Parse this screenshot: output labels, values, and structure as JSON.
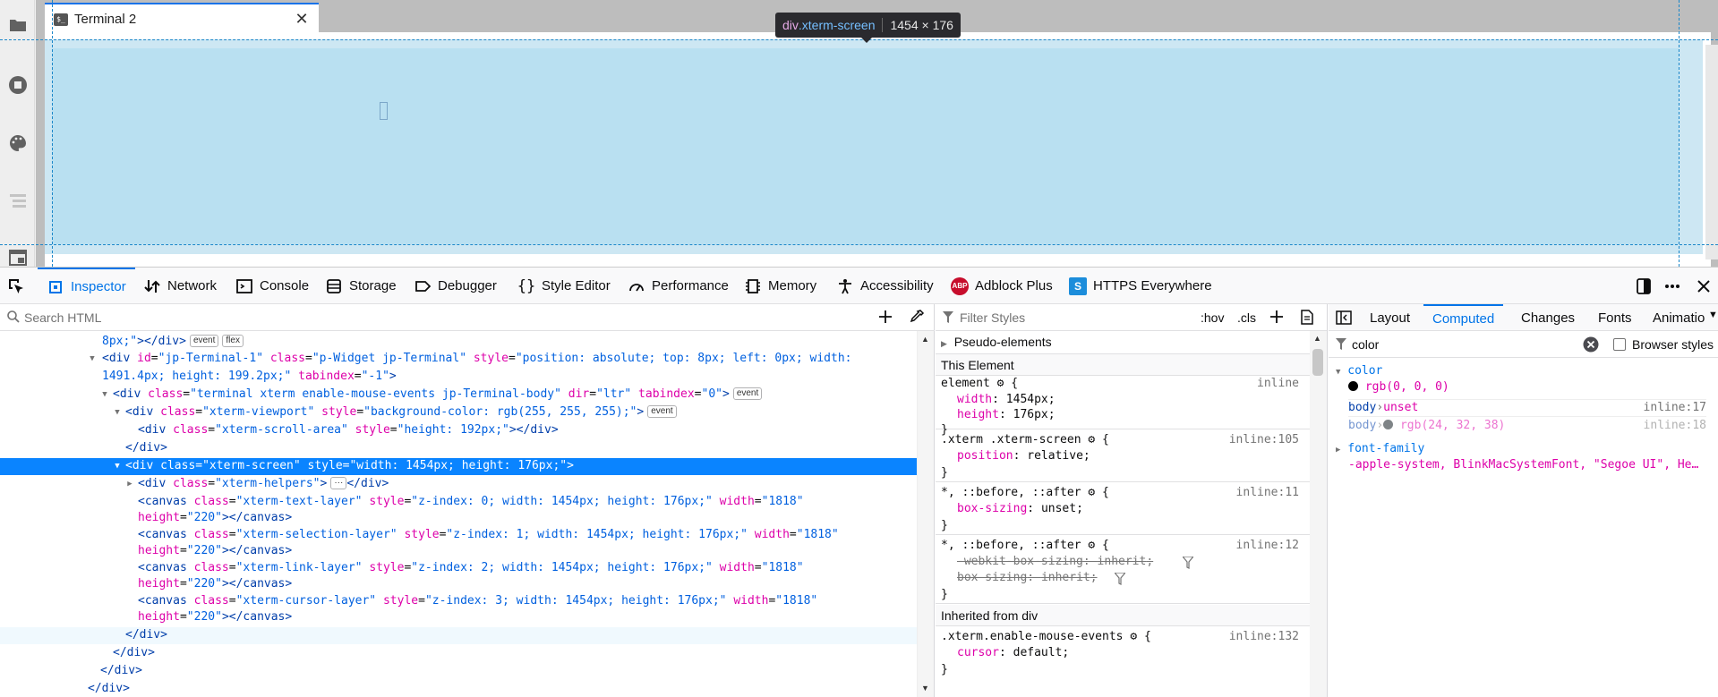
{
  "page": {
    "tab_title": "Terminal 2",
    "tab_icon_text": "$_",
    "close_glyph": "✕",
    "tooltip": {
      "tag": "div",
      "cls": ".xterm-screen",
      "size": "1454 × 176"
    }
  },
  "devtools": {
    "tabs": {
      "inspector": "Inspector",
      "network": "Network",
      "console": "Console",
      "storage": "Storage",
      "debugger": "Debugger",
      "style_editor": "Style Editor",
      "performance": "Performance",
      "memory": "Memory",
      "accessibility": "Accessibility",
      "adblock": "Adblock Plus",
      "https": "HTTPS Everywhere"
    },
    "adblock_badge": "ABP",
    "https_badge": "S",
    "markup": {
      "search_placeholder": "Search HTML",
      "lines": [
        {
          "text_html": "<span class=\"av\">8px;\"</span><span class=\"t\">&gt;&lt;/div&gt;</span><span class=\"badge\">event</span><span class=\"badge\">flex</span>"
        },
        {
          "text_html": "<span class=\"t\">&lt;div </span><span class=\"an\">id</span>=<span class=\"av\">\"jp-Terminal-1\"</span> <span class=\"an\">class</span>=<span class=\"av\">\"p-Widget jp-Terminal\"</span> <span class=\"an\">style</span>=<span class=\"av\">\"position: absolute; top: 8px; left: 0px; width:</span>"
        },
        {
          "text_html": "<span class=\"av\">1491.4px; height: 199.2px;\"</span> <span class=\"an\">tabindex</span>=<span class=\"av\">\"-1\"</span><span class=\"t\">&gt;</span>"
        },
        {
          "text_html": "<span class=\"t\">&lt;div </span><span class=\"an\">class</span>=<span class=\"av\">\"terminal xterm enable-mouse-events jp-Terminal-body\"</span> <span class=\"an\">dir</span>=<span class=\"av\">\"ltr\"</span> <span class=\"an\">tabindex</span>=<span class=\"av\">\"0\"</span><span class=\"t\">&gt;</span><span class=\"badge\">event</span>"
        },
        {
          "text_html": "<span class=\"t\">&lt;div </span><span class=\"an\">class</span>=<span class=\"av\">\"xterm-viewport\"</span> <span class=\"an\">style</span>=<span class=\"av\">\"background-color: rgb(255, 255, 255);\"</span><span class=\"t\">&gt;</span><span class=\"badge\">event</span>"
        },
        {
          "text_html": "<span class=\"t\">&lt;div </span><span class=\"an\">class</span>=<span class=\"av\">\"xterm-scroll-area\"</span> <span class=\"an\">style</span>=<span class=\"av\">\"height: 192px;\"</span><span class=\"t\">&gt;&lt;/div&gt;</span>"
        },
        {
          "text_html": "<span class=\"t\">&lt;/div&gt;</span>"
        },
        {
          "text_html": "<span class=\"t\">&lt;div </span><span class=\"an\">class</span>=<span class=\"av\">\"xterm-screen\"</span> <span class=\"an\">style</span>=<span class=\"av\">\"width: 1454px; height: 176px;\"</span><span class=\"t\">&gt;</span>"
        },
        {
          "text_html": "<span class=\"t\">&lt;div </span><span class=\"an\">class</span>=<span class=\"av\">\"xterm-helpers\"</span><span class=\"t\">&gt;</span><span class=\"badge\">···</span><span class=\"t\">&lt;/div&gt;</span>"
        },
        {
          "text_html": "<span class=\"t\">&lt;canvas </span><span class=\"an\">class</span>=<span class=\"av\">\"xterm-text-layer\"</span> <span class=\"an\">style</span>=<span class=\"av\">\"z-index: 0; width: 1454px; height: 176px;\"</span> <span class=\"an\">width</span>=<span class=\"av\">\"1818\"</span>"
        },
        {
          "text_html": "<span class=\"an\">height</span>=<span class=\"av\">\"220\"</span><span class=\"t\">&gt;&lt;/canvas&gt;</span>"
        },
        {
          "text_html": "<span class=\"t\">&lt;canvas </span><span class=\"an\">class</span>=<span class=\"av\">\"xterm-selection-layer\"</span> <span class=\"an\">style</span>=<span class=\"av\">\"z-index: 1; width: 1454px; height: 176px;\"</span> <span class=\"an\">width</span>=<span class=\"av\">\"1818\"</span>"
        },
        {
          "text_html": "<span class=\"an\">height</span>=<span class=\"av\">\"220\"</span><span class=\"t\">&gt;&lt;/canvas&gt;</span>"
        },
        {
          "text_html": "<span class=\"t\">&lt;canvas </span><span class=\"an\">class</span>=<span class=\"av\">\"xterm-link-layer\"</span> <span class=\"an\">style</span>=<span class=\"av\">\"z-index: 2; width: 1454px; height: 176px;\"</span> <span class=\"an\">width</span>=<span class=\"av\">\"1818\"</span>"
        },
        {
          "text_html": "<span class=\"an\">height</span>=<span class=\"av\">\"220\"</span><span class=\"t\">&gt;&lt;/canvas&gt;</span>"
        },
        {
          "text_html": "<span class=\"t\">&lt;canvas </span><span class=\"an\">class</span>=<span class=\"av\">\"xterm-cursor-layer\"</span> <span class=\"an\">style</span>=<span class=\"av\">\"z-index: 3; width: 1454px; height: 176px;\"</span> <span class=\"an\">width</span>=<span class=\"av\">\"1818\"</span>"
        },
        {
          "text_html": "<span class=\"an\">height</span>=<span class=\"av\">\"220\"</span><span class=\"t\">&gt;&lt;/canvas&gt;</span>"
        },
        {
          "text_html": "<span class=\"t\">&lt;/div&gt;</span>"
        },
        {
          "text_html": "<span class=\"t\">&lt;/div&gt;</span>"
        },
        {
          "text_html": "<span class=\"t\">&lt;/div&gt;</span>"
        },
        {
          "text_html": "<span class=\"t\">&lt;/div&gt;</span>"
        },
        {
          "text_html": "<span class=\"t\">&lt;/div&gt;</span>"
        }
      ]
    },
    "rules": {
      "filter_placeholder": "Filter Styles",
      "hov": ":hov",
      "cls": ".cls",
      "pseudo": "Pseudo-elements",
      "this_element": "This Element",
      "inherited_from": "Inherited from div",
      "r1_sel": "element",
      "r1_src": "inline",
      "r1_p1": "width",
      "r1_v1": "1454px",
      "r1_p2": "height",
      "r1_v2": "176px",
      "r2_sel": ".xterm .xterm-screen",
      "r2_src": "inline:105",
      "r2_p1": "position",
      "r2_v1": "relative",
      "r3_sel": "*, ::before, ::after",
      "r3_src": "inline:11",
      "r3_p1": "box-sizing",
      "r3_v1": "unset",
      "r4_sel": "*, ::before, ::after",
      "r4_src": "inline:12",
      "r4_p1": "-webkit-box-sizing",
      "r4_v1": "inherit",
      "r4_p2": "box-sizing",
      "r4_v2": "inherit",
      "r5_sel": ".xterm.enable-mouse-events",
      "r5_src": "inline:132",
      "r5_p1": "cursor",
      "r5_v1": "default"
    },
    "computed": {
      "tabs": {
        "layout": "Layout",
        "computed": "Computed",
        "changes": "Changes",
        "fonts": "Fonts",
        "animations": "Animatio"
      },
      "filter_value": "color",
      "browser_styles": "Browser styles",
      "color_prop": "color",
      "color_value": "rgb(0, 0, 0)",
      "src1_sel": "body",
      "src1_val": "unset",
      "src1_loc": "inline:17",
      "src2_sel": "body",
      "src2_val": "rgb(24, 32, 38)",
      "src2_loc": "inline:18",
      "font_prop": "font-family",
      "font_value": "-apple-system, BlinkMacSystemFont, \"Segoe UI\", He…"
    }
  }
}
